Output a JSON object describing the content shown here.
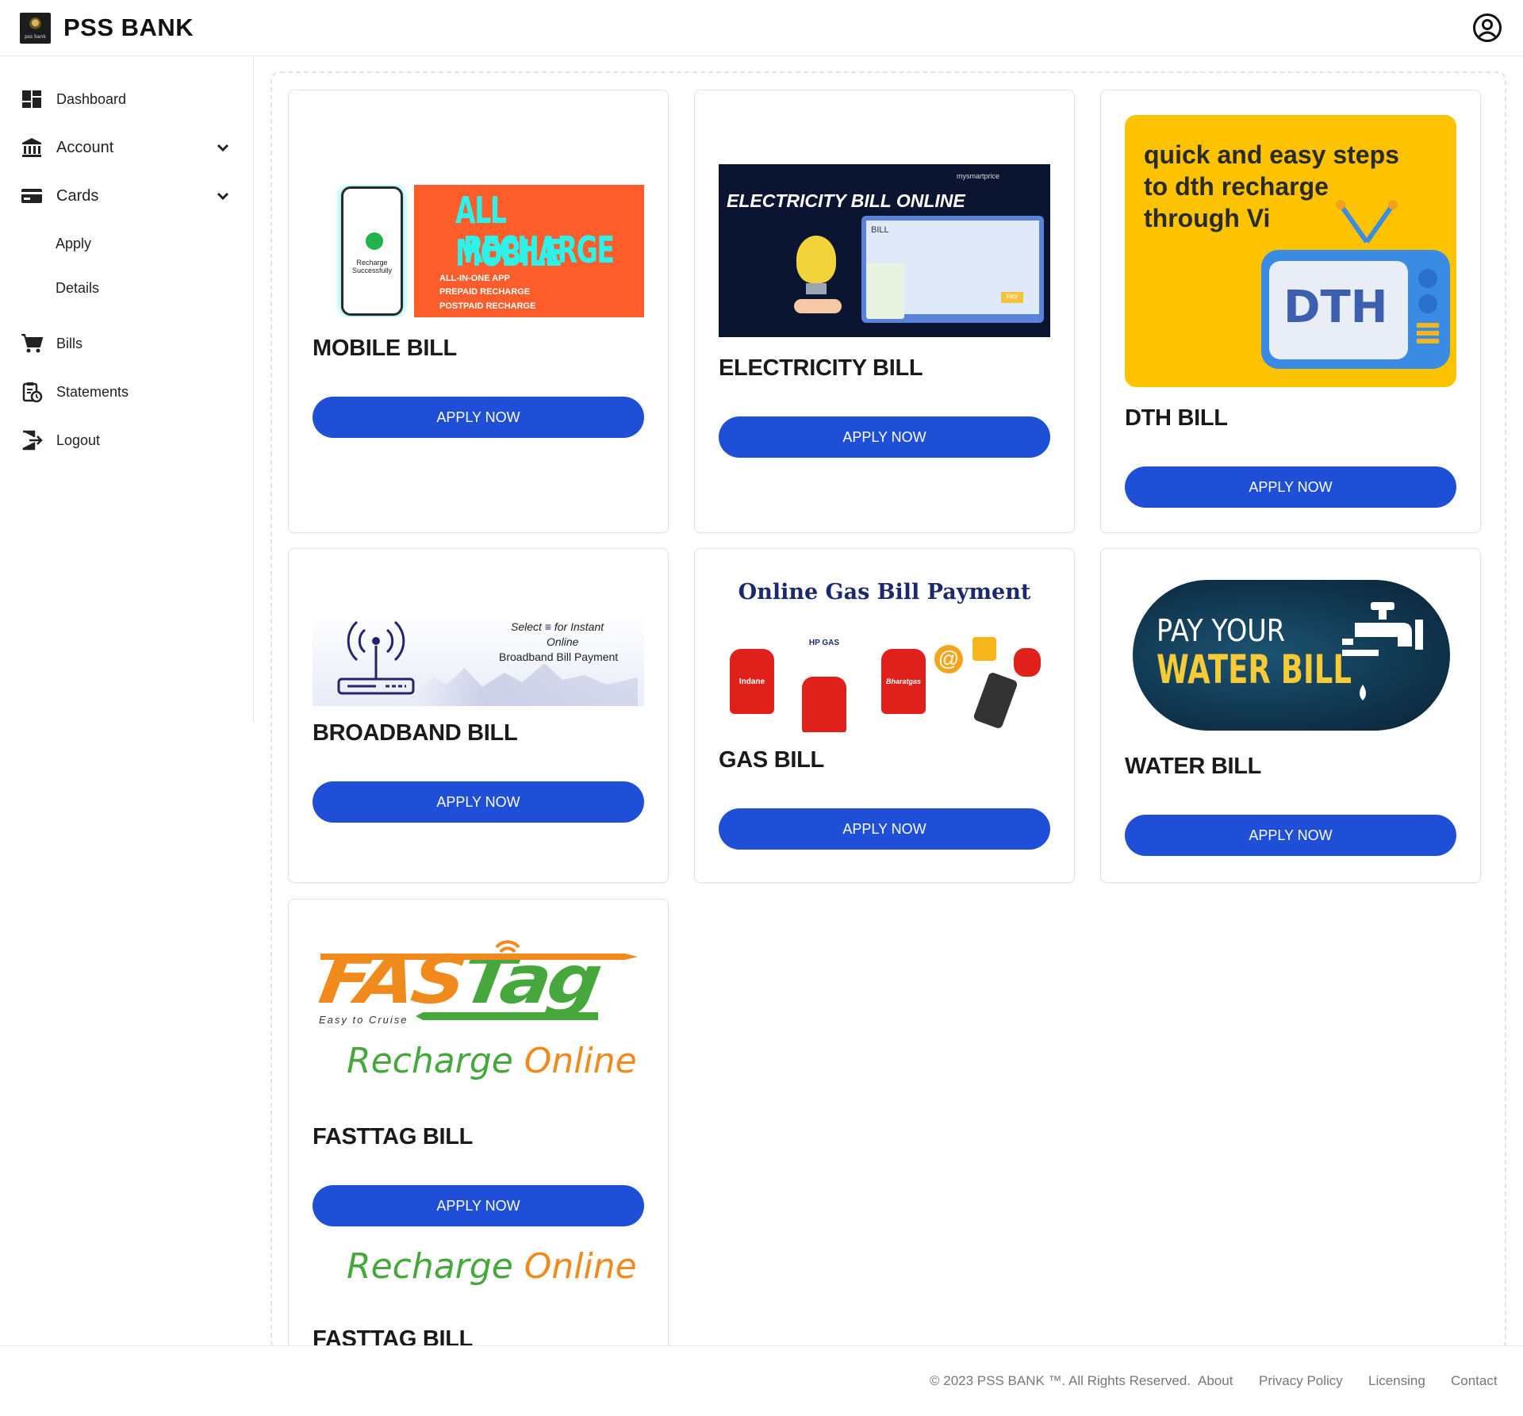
{
  "header": {
    "brand": "PSS BANK",
    "logo_caption": "pss bank",
    "profile_icon": "account-circle-icon"
  },
  "sidebar": {
    "items": [
      {
        "label": "Dashboard",
        "icon": "dashboard-icon"
      },
      {
        "label": "Account",
        "icon": "bank-icon"
      },
      {
        "label": "Cards",
        "icon": "credit-card-icon"
      },
      {
        "label": "Apply"
      },
      {
        "label": "Details"
      },
      {
        "label": "Bills",
        "icon": "cart-icon"
      },
      {
        "label": "Statements",
        "icon": "clipboard-clock-icon"
      },
      {
        "label": "Logout",
        "icon": "logout-icon"
      }
    ]
  },
  "cards": [
    {
      "title": "MOBILE BILL",
      "button": "APPLY NOW",
      "image_text": {
        "headline1": "ALL MOBILE",
        "headline2": "RECHARGE",
        "bullet1": "ALL-IN-ONE APP",
        "bullet2": "PREPAID RECHARGE",
        "bullet3": "POSTPAID RECHARGE",
        "phone_text": "Recharge Successfully"
      }
    },
    {
      "title": "ELECTRICITY BILL",
      "button": "APPLY NOW",
      "image_text": {
        "headline": "ELECTRICITY BILL ONLINE",
        "brand": "mysmartprice",
        "bill": "BILL",
        "pay": "PAY"
      }
    },
    {
      "title": "DTH BILL",
      "button": "APPLY NOW",
      "image_text": {
        "line1": "quick and easy steps",
        "line2": "to dth recharge",
        "line3": "through Vi",
        "tv": "DTH"
      }
    },
    {
      "title": "BROADBAND BILL",
      "button": "APPLY NOW",
      "image_text": {
        "line1": "Select",
        "line1b": "for Instant",
        "line2": "Online",
        "line3": "Broadband Bill Payment"
      }
    },
    {
      "title": "GAS BILL",
      "button": "APPLY NOW",
      "image_text": {
        "headline": "Online Gas Bill Payment",
        "brand1": "Indane",
        "brand2": "HP GAS",
        "brand3": "Bharatgas"
      }
    },
    {
      "title": "WATER BILL",
      "button": "APPLY NOW",
      "image_text": {
        "line1": "PAY YOUR",
        "line2": "WATER BILL"
      }
    },
    {
      "title": "FASTTAG BILL",
      "button": "APPLY NOW",
      "image_text": {
        "logo": "FASTag",
        "tagline": "Easy to Cruise",
        "recharge": "Recharge",
        "online": "Online"
      },
      "repeat_text": {
        "recharge": "Recharge",
        "online": "Online",
        "title": "FASTTAG BILL"
      }
    }
  ],
  "footer": {
    "copyright": "© 2023 PSS BANK ™. All Rights Reserved.",
    "links": [
      "About",
      "Privacy Policy",
      "Licensing",
      "Contact"
    ]
  },
  "colors": {
    "accent": "#1f4fd6",
    "text": "#111111",
    "muted": "#777777"
  }
}
